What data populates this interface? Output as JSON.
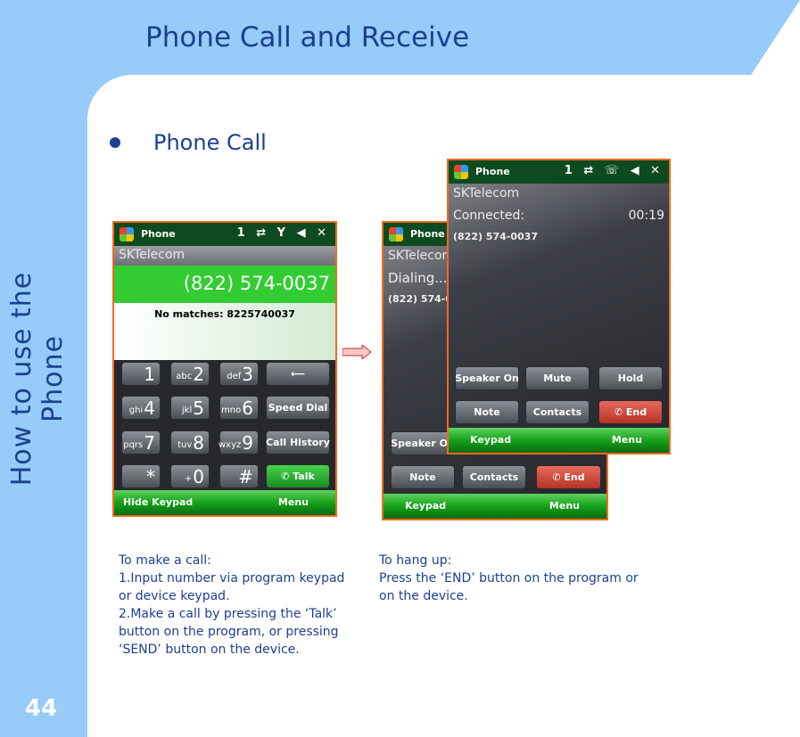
{
  "page": {
    "title": "Phone Call and Receive",
    "chapter": "How to use the Phone",
    "page_number": "44",
    "section": "Phone Call"
  },
  "screen_dial": {
    "app": "Phone",
    "status_icons": "1 ⇄ Y ◀ ✕",
    "carrier": "SKTelecom",
    "number": "(822) 574-0037",
    "matches": "No matches: 8225740037",
    "keys": [
      {
        "sub": "",
        "main": "1"
      },
      {
        "sub": "abc",
        "main": "2"
      },
      {
        "sub": "def",
        "main": "3"
      },
      {
        "sub": "",
        "main": "⟵"
      },
      {
        "sub": "ghi",
        "main": "4"
      },
      {
        "sub": "jkl",
        "main": "5"
      },
      {
        "sub": "mno",
        "main": "6"
      },
      {
        "sub": "",
        "main": "Speed Dial"
      },
      {
        "sub": "pqrs",
        "main": "7"
      },
      {
        "sub": "tuv",
        "main": "8"
      },
      {
        "sub": "wxyz",
        "main": "9"
      },
      {
        "sub": "",
        "main": "Call History"
      },
      {
        "sub": "",
        "main": "*"
      },
      {
        "sub": "+",
        "main": "0"
      },
      {
        "sub": "",
        "main": "#"
      },
      {
        "sub": "",
        "main": "Talk"
      }
    ],
    "left_soft": "Hide Keypad",
    "right_soft": "Menu"
  },
  "screen_dialing": {
    "app": "Phone",
    "carrier": "SKTelecom",
    "status": "Dialing...",
    "number": "(822) 574-0037",
    "buttons": [
      "Speaker On",
      "Note",
      "Contacts",
      "End"
    ],
    "left_soft": "Keypad",
    "right_soft": "Menu"
  },
  "screen_connected": {
    "app": "Phone",
    "status_icons": "1 ⇄ ☏ ◀ ✕",
    "carrier": "SKTelecom",
    "status": "Connected:",
    "timer": "00:19",
    "number": "(822) 574-0037",
    "buttons": [
      "Speaker On",
      "Mute",
      "Hold",
      "Note",
      "Contacts",
      "End"
    ],
    "left_soft": "Keypad",
    "right_soft": "Menu"
  },
  "instructions": {
    "call": [
      "To make a call:",
      "1.Input number via program keypad",
      "or device keypad.",
      "2.Make a call by pressing the ‘Talk’",
      "button on the program, or pressing",
      "‘SEND’ button on the device."
    ],
    "hangup": [
      "To hang up:",
      "Press the ‘END’ button on the program or",
      "on the device."
    ]
  },
  "colors": {
    "accent": "#97cbf8",
    "text": "#1d3f8f",
    "frame": "#f26b1d"
  }
}
